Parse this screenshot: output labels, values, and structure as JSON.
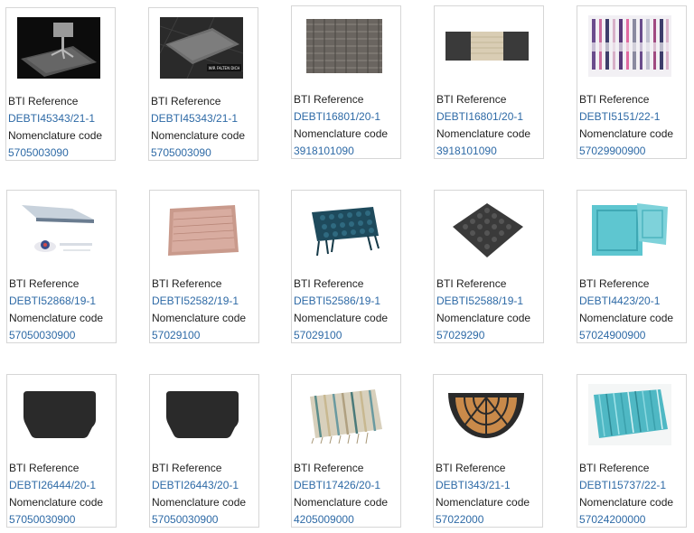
{
  "labels": {
    "bti_reference": "BTI Reference",
    "nomenclature_code": "Nomenclature code"
  },
  "cards": [
    {
      "reference": "DEBTI45343/21-1",
      "code": "5705003090",
      "image": "chair-mat-dark"
    },
    {
      "reference": "DEBTI45343/21-1",
      "code": "5705003090",
      "image": "mat-on-floor",
      "image_badge": "WIR FALTEN DICH"
    },
    {
      "reference": "DEBTI16801/20-1",
      "code": "3918101090",
      "image": "woven-grey-sample"
    },
    {
      "reference": "DEBTI16801/20-1",
      "code": "3918101090",
      "image": "beige-runner"
    },
    {
      "reference": "DEBTI5151/22-1",
      "code": "57029900900",
      "image": "striped-rag-rugs"
    },
    {
      "reference": "DEBTI52868/19-1",
      "code": "57050030900",
      "image": "sheet-and-disc"
    },
    {
      "reference": "DEBTI52582/19-1",
      "code": "57029100",
      "image": "pink-bath-mat"
    },
    {
      "reference": "DEBTI52586/19-1",
      "code": "57029100",
      "image": "teal-fringed-rug"
    },
    {
      "reference": "DEBTI52588/19-1",
      "code": "57029290",
      "image": "dark-knitted-mat"
    },
    {
      "reference": "DEBTI4423/20-1",
      "code": "57024900900",
      "image": "turquoise-bath-mats"
    },
    {
      "reference": "DEBTI26444/20-1",
      "code": "57050030900",
      "image": "black-floor-mat"
    },
    {
      "reference": "DEBTI26443/20-1",
      "code": "57050030900",
      "image": "black-floor-mat"
    },
    {
      "reference": "DEBTI17426/20-1",
      "code": "4205009000",
      "image": "striped-fringe-rug"
    },
    {
      "reference": "DEBTI343/21-1",
      "code": "57022000",
      "image": "half-round-coir-doormat"
    },
    {
      "reference": "DEBTI15737/22-1",
      "code": "57024200000",
      "image": "turquoise-shag-rug"
    }
  ]
}
